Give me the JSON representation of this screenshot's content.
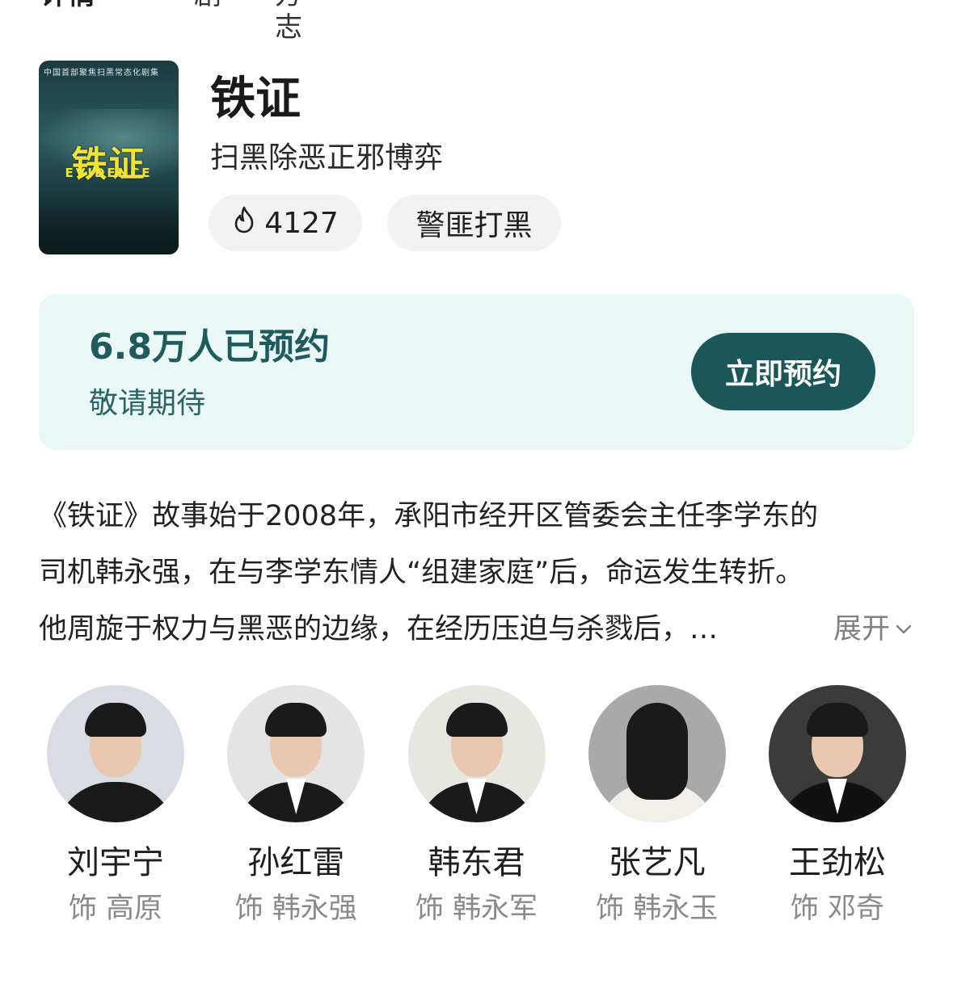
{
  "header_tabs": [
    "详情",
    "剧",
    "方志"
  ],
  "show": {
    "poster": {
      "top_text": "中国首部聚焦扫黑常态化剧集",
      "title": "铁证",
      "subtitle": "EVIDENCE"
    },
    "title": "铁证",
    "subtitle": "扫黑除恶正邪博弈",
    "heat": "4127",
    "genre": "警匪打黑"
  },
  "reserve": {
    "count_text": "6.8万人已预约",
    "sub_text": "敬请期待",
    "button_label": "立即预约",
    "accent": "#1b5658",
    "background": "#e9f7f6"
  },
  "synopsis": {
    "line1": "《铁证》故事始于2008年，承阳市经开区管委会主任李学东的",
    "line2": "司机韩永强，在与李学东情人“组建家庭”后，命运发生转折。",
    "line3": "他周旋于权力与黑恶的边缘，在经历压迫与杀戮后，…",
    "expand_label": "展开"
  },
  "cast": [
    {
      "name": "刘宇宁",
      "role": "饰 高原",
      "bg": "#d9dde3"
    },
    {
      "name": "孙红雷",
      "role": "饰 韩永强",
      "bg": "#e4e4e4"
    },
    {
      "name": "韩东君",
      "role": "饰 韩永军",
      "bg": "#e7e7e2"
    },
    {
      "name": "张艺凡",
      "role": "饰 韩永玉",
      "bg": "#a9a9a9"
    },
    {
      "name": "王劲松",
      "role": "饰 邓奇",
      "bg": "#3b3b3b"
    }
  ]
}
